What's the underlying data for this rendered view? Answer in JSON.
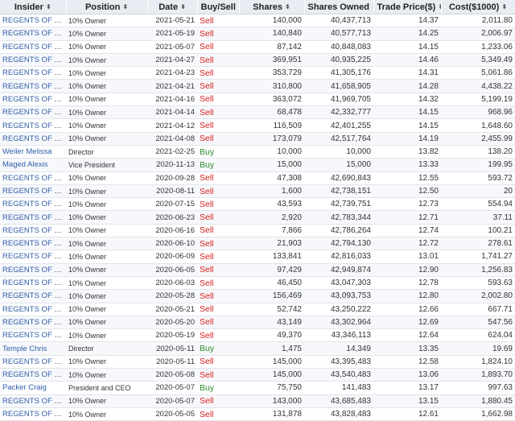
{
  "columns": [
    {
      "key": "insider",
      "label": "Insider"
    },
    {
      "key": "position",
      "label": "Position"
    },
    {
      "key": "date",
      "label": "Date"
    },
    {
      "key": "buysell",
      "label": "Buy/Sell"
    },
    {
      "key": "shares",
      "label": "Shares"
    },
    {
      "key": "owned",
      "label": "Shares Owned"
    },
    {
      "key": "price",
      "label": "Trade Price($)"
    },
    {
      "key": "cost",
      "label": "Cost($1000)"
    }
  ],
  "sort_glyph": "⬍",
  "colors": {
    "sell": "#d81e1e",
    "buy": "#2a8a2a",
    "link": "#2f5da8",
    "header_bg": "#e9ecf2"
  },
  "rows": [
    [
      "REGENTS OF THE...",
      "10% Owner",
      "2021-05-21",
      "Sell",
      "140,000",
      "40,437,713",
      "14.37",
      "2,011.80"
    ],
    [
      "REGENTS OF THE...",
      "10% Owner",
      "2021-05-19",
      "Sell",
      "140,840",
      "40,577,713",
      "14.25",
      "2,006.97"
    ],
    [
      "REGENTS OF THE...",
      "10% Owner",
      "2021-05-07",
      "Sell",
      "87,142",
      "40,848,083",
      "14.15",
      "1,233.06"
    ],
    [
      "REGENTS OF THE...",
      "10% Owner",
      "2021-04-27",
      "Sell",
      "369,951",
      "40,935,225",
      "14.46",
      "5,349.49"
    ],
    [
      "REGENTS OF THE...",
      "10% Owner",
      "2021-04-23",
      "Sell",
      "353,729",
      "41,305,176",
      "14.31",
      "5,061.86"
    ],
    [
      "REGENTS OF THE...",
      "10% Owner",
      "2021-04-21",
      "Sell",
      "310,800",
      "41,658,905",
      "14.28",
      "4,438.22"
    ],
    [
      "REGENTS OF THE...",
      "10% Owner",
      "2021-04-16",
      "Sell",
      "363,072",
      "41,969,705",
      "14.32",
      "5,199.19"
    ],
    [
      "REGENTS OF THE...",
      "10% Owner",
      "2021-04-14",
      "Sell",
      "68,478",
      "42,332,777",
      "14.15",
      "968.96"
    ],
    [
      "REGENTS OF THE...",
      "10% Owner",
      "2021-04-12",
      "Sell",
      "116,509",
      "42,401,255",
      "14.15",
      "1,648.60"
    ],
    [
      "REGENTS OF THE...",
      "10% Owner",
      "2021-04-08",
      "Sell",
      "173,079",
      "42,517,764",
      "14.19",
      "2,455.99"
    ],
    [
      "Weiler Melissa",
      "Director",
      "2021-02-25",
      "Buy",
      "10,000",
      "10,000",
      "13.82",
      "138.20"
    ],
    [
      "Maged Alexis",
      "Vice President",
      "2020-11-13",
      "Buy",
      "15,000",
      "15,000",
      "13.33",
      "199.95"
    ],
    [
      "REGENTS OF THE...",
      "10% Owner",
      "2020-09-28",
      "Sell",
      "47,308",
      "42,690,843",
      "12.55",
      "593.72"
    ],
    [
      "REGENTS OF THE...",
      "10% Owner",
      "2020-08-11",
      "Sell",
      "1,600",
      "42,738,151",
      "12.50",
      "20"
    ],
    [
      "REGENTS OF THE...",
      "10% Owner",
      "2020-07-15",
      "Sell",
      "43,593",
      "42,739,751",
      "12.73",
      "554.94"
    ],
    [
      "REGENTS OF THE...",
      "10% Owner",
      "2020-06-23",
      "Sell",
      "2,920",
      "42,783,344",
      "12.71",
      "37.11"
    ],
    [
      "REGENTS OF THE...",
      "10% Owner",
      "2020-06-16",
      "Sell",
      "7,866",
      "42,786,264",
      "12.74",
      "100.21"
    ],
    [
      "REGENTS OF THE...",
      "10% Owner",
      "2020-06-10",
      "Sell",
      "21,903",
      "42,794,130",
      "12.72",
      "278.61"
    ],
    [
      "REGENTS OF THE...",
      "10% Owner",
      "2020-06-09",
      "Sell",
      "133,841",
      "42,816,033",
      "13.01",
      "1,741.27"
    ],
    [
      "REGENTS OF THE...",
      "10% Owner",
      "2020-06-05",
      "Sell",
      "97,429",
      "42,949,874",
      "12.90",
      "1,256.83"
    ],
    [
      "REGENTS OF THE...",
      "10% Owner",
      "2020-06-03",
      "Sell",
      "46,450",
      "43,047,303",
      "12.78",
      "593.63"
    ],
    [
      "REGENTS OF THE...",
      "10% Owner",
      "2020-05-28",
      "Sell",
      "156,469",
      "43,093,753",
      "12.80",
      "2,002.80"
    ],
    [
      "REGENTS OF THE...",
      "10% Owner",
      "2020-05-21",
      "Sell",
      "52,742",
      "43,250,222",
      "12.66",
      "667.71"
    ],
    [
      "REGENTS OF THE...",
      "10% Owner",
      "2020-05-20",
      "Sell",
      "43,149",
      "43,302,964",
      "12.69",
      "547.56"
    ],
    [
      "REGENTS OF THE...",
      "10% Owner",
      "2020-05-19",
      "Sell",
      "49,370",
      "43,346,113",
      "12.64",
      "624.04"
    ],
    [
      "Temple Chris",
      "Director",
      "2020-05-11",
      "Buy",
      "1,475",
      "14,349",
      "13.35",
      "19.69"
    ],
    [
      "REGENTS OF THE...",
      "10% Owner",
      "2020-05-11",
      "Sell",
      "145,000",
      "43,395,483",
      "12.58",
      "1,824.10"
    ],
    [
      "REGENTS OF THE...",
      "10% Owner",
      "2020-05-08",
      "Sell",
      "145,000",
      "43,540,483",
      "13.06",
      "1,893.70"
    ],
    [
      "Packer Craig",
      "President and CEO",
      "2020-05-07",
      "Buy",
      "75,750",
      "141,483",
      "13.17",
      "997.63"
    ],
    [
      "REGENTS OF THE...",
      "10% Owner",
      "2020-05-07",
      "Sell",
      "143,000",
      "43,685,483",
      "13.15",
      "1,880.45"
    ],
    [
      "REGENTS OF THE...",
      "10% Owner",
      "2020-05-05",
      "Sell",
      "131,878",
      "43,828,483",
      "12.61",
      "1,662.98"
    ]
  ]
}
